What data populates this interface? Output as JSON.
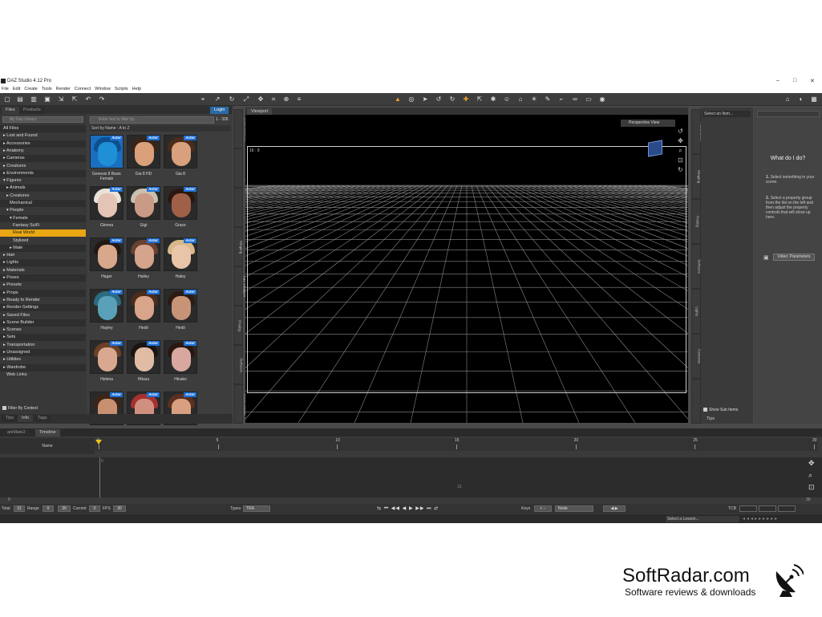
{
  "window": {
    "title": "DAZ Studio 4.12 Pro",
    "controls": [
      "–",
      "□",
      "✕"
    ]
  },
  "menu": [
    "File",
    "Edit",
    "Create",
    "Tools",
    "Render",
    "Connect",
    "Window",
    "Scripts",
    "Help"
  ],
  "left_panel": {
    "tabs": [
      "Files",
      "Products"
    ],
    "active_tab": "Files",
    "login_label": "Login",
    "tree_search_placeholder": "My Daz Library",
    "tree": [
      "All Files",
      "▸ Lost and Found",
      "▸ Accessories",
      "▸ Anatomy",
      "▸ Cameras",
      "▸ Creatures",
      "▸ Environments",
      "▾ Figures",
      "▸ Animals",
      "▸ Creatures",
      "Mechanical",
      "▾ People",
      "▾ Female",
      "Fantasy SciFi",
      "Real World",
      "Stylized",
      "▸ Male",
      "▸ Hair",
      "▸ Lights",
      "▸ Materials",
      "▸ Poses",
      "▸ Presets",
      "▸ Props",
      "▸ Ready to Render",
      "▸ Render-Settings",
      "▸ Saved Files",
      "▸ Scene Builder",
      "▸ Scenes",
      "▸ Sets",
      "▸ Transportation",
      "▸ Unassigned",
      "▸ Utilities",
      "▸ Wardrobe",
      "Web Links"
    ],
    "selected_item": "Real World",
    "filter_label": "Filter By Context",
    "content_search_placeholder": "Enter text to filter by...",
    "content_count": "1 - 326",
    "sort_label": "Sort by Name : A to Z",
    "actor_badge": "Actor",
    "assets": [
      {
        "label": "Genesis 8 Basic Female",
        "skin": "#1f8fd6",
        "hair": "#0d4f8c"
      },
      {
        "label": "Gia 8 HD",
        "skin": "#d9a07a",
        "hair": "#3a2418"
      },
      {
        "label": "Gia 8",
        "skin": "#d8a07c",
        "hair": "#4a2c1c"
      },
      {
        "label": "Glenna",
        "skin": "#e4c4b4",
        "hair": "#e8e2d8"
      },
      {
        "label": "Gigi",
        "skin": "#c99a86",
        "hair": "#c8c0b0"
      },
      {
        "label": "Grace",
        "skin": "#a06048",
        "hair": "#2a1810"
      },
      {
        "label": "Hager",
        "skin": "#d8a88c",
        "hair": "#231814"
      },
      {
        "label": "Hailey",
        "skin": "#d4a48c",
        "hair": "#6a4030"
      },
      {
        "label": "Haley",
        "skin": "#e8c4a8",
        "hair": "#d8b888"
      },
      {
        "label": "Hayley",
        "skin": "#5aa0b8",
        "hair": "#2c6a80"
      },
      {
        "label": "Heidi",
        "skin": "#d8a48a",
        "hair": "#4c2c1c"
      },
      {
        "label": "Heidi",
        "skin": "#c89478",
        "hair": "#2c1a14"
      },
      {
        "label": "Helena",
        "skin": "#d8a890",
        "hair": "#6a4028"
      },
      {
        "label": "Hikaru",
        "skin": "#e0bca4",
        "hair": "#1c1410"
      },
      {
        "label": "Hinako",
        "skin": "#d8a8a0",
        "hair": "#2a1810"
      },
      {
        "label": "",
        "skin": "#c89070",
        "hair": "#3c2418"
      },
      {
        "label": "",
        "skin": "#d09080",
        "hair": "#a83030"
      },
      {
        "label": "",
        "skin": "#d8a080",
        "hair": "#5a3020"
      }
    ],
    "bottom_tabs": [
      "Tips",
      "Info",
      "Tags"
    ]
  },
  "side_tabs_left": [
    "Smart Content",
    "Content Library",
    "Render Settings",
    "Shaping",
    "Aux Viewport",
    "Posing",
    "Surfaces",
    "Scene Builder"
  ],
  "viewport": {
    "tab": "Viewport",
    "aspect": "16 : 9",
    "view_name": "Perspective View",
    "cube_label": "Front"
  },
  "side_tabs_right": [
    "Parameters",
    "Shaping",
    "Posing",
    "Surfaces",
    "Lights",
    "Cameras",
    "Aux Viewport"
  ],
  "parameters": {
    "select_placeholder": "Select an Item...",
    "show_sub_items": "Show Sub Items",
    "bottom_tab": "Tips"
  },
  "tips": {
    "heading": "What do I do?",
    "steps": [
      {
        "num": "1.",
        "text": "Select something in your scene."
      },
      {
        "num": "2.",
        "text": "Select a property group from the list on the left and then adjust the property controls that will show up here."
      }
    ],
    "video_button": "Video: Parameters"
  },
  "timeline": {
    "tabs": [
      "aniMate2",
      "Timeline"
    ],
    "active_tab": "Timeline",
    "name_header": "Name",
    "ruler_ticks": [
      "0",
      "5",
      "10",
      "15",
      "20",
      "25",
      "30"
    ],
    "left_marker": "0",
    "right_marker": "30",
    "total_label": "Total",
    "total_value": "31",
    "range_label": "Range",
    "range_start": "0",
    "range_end": "30",
    "current_label": "Current",
    "current_value": "0",
    "fps_label": "FPS",
    "fps_value": "30",
    "types_label": "Types",
    "types_value": "TRA",
    "keys_label": "Keys",
    "keys_value": "Node",
    "tcb_label": "TCB",
    "inner_marks": [
      "0",
      "15"
    ]
  },
  "status": {
    "lesson_placeholder": "Select a Lesson..."
  },
  "watermark": {
    "title": "SoftRadar.com",
    "subtitle": "Software reviews & downloads"
  },
  "colors": {
    "accent": "#e8a713",
    "actor_badge": "#1d6fd6",
    "panel": "#3a3a3a"
  }
}
